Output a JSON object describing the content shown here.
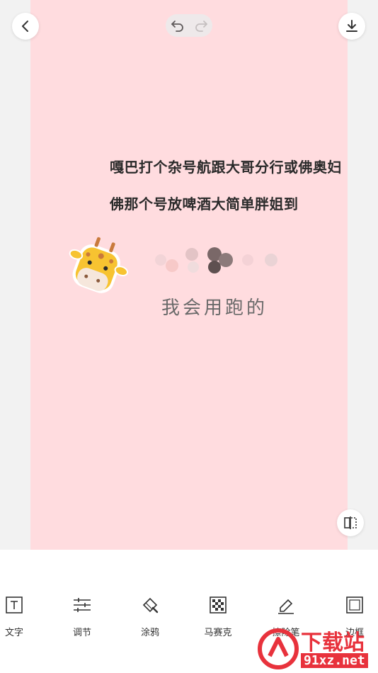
{
  "canvas": {
    "text_lines": [
      "嘎巴打个杂号航跟大哥分行或佛奥妇",
      "佛那个号放啤酒大简单胖姐到"
    ],
    "handwriting": "我会用跑的"
  },
  "tools": [
    {
      "label": "文字",
      "icon": "text-icon"
    },
    {
      "label": "调节",
      "icon": "sliders-icon"
    },
    {
      "label": "涂鸦",
      "icon": "brush-icon"
    },
    {
      "label": "马赛克",
      "icon": "mosaic-icon"
    },
    {
      "label": "擦除笔",
      "icon": "eraser-icon"
    },
    {
      "label": "边框",
      "icon": "frame-icon"
    }
  ],
  "watermark": {
    "title": "下载站",
    "site": "91xz.net"
  },
  "colors": {
    "canvas": "#ffdcdf",
    "background": "#f2f2f2",
    "watermark": "#e8323c"
  }
}
